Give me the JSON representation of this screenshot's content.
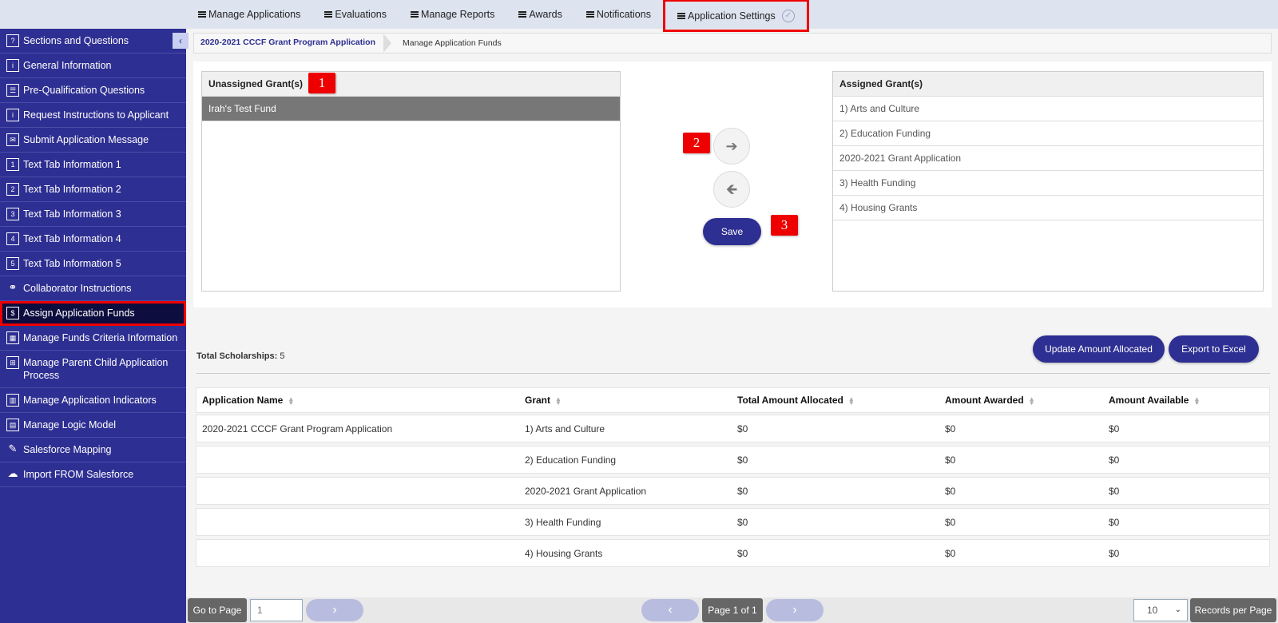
{
  "topnav": {
    "items": [
      {
        "label": "Manage Applications"
      },
      {
        "label": "Evaluations"
      },
      {
        "label": "Manage Reports"
      },
      {
        "label": "Awards"
      },
      {
        "label": "Notifications"
      },
      {
        "label": "Application Settings"
      }
    ]
  },
  "sidebar": {
    "items": [
      {
        "label": "Sections and Questions",
        "icon": "?"
      },
      {
        "label": "General Information",
        "icon": "i"
      },
      {
        "label": "Pre-Qualification Questions",
        "icon": "☰"
      },
      {
        "label": "Request Instructions to Applicant",
        "icon": "i"
      },
      {
        "label": "Submit Application Message",
        "icon": "✉"
      },
      {
        "label": "Text Tab Information 1",
        "icon": "1"
      },
      {
        "label": "Text Tab Information 2",
        "icon": "2"
      },
      {
        "label": "Text Tab Information 3",
        "icon": "3"
      },
      {
        "label": "Text Tab Information 4",
        "icon": "4"
      },
      {
        "label": "Text Tab Information 5",
        "icon": "5"
      },
      {
        "label": "Collaborator Instructions",
        "icon": "⚭"
      },
      {
        "label": "Assign Application Funds",
        "icon": "$"
      },
      {
        "label": "Manage Funds Criteria Information",
        "icon": "▦"
      },
      {
        "label": "Manage Parent Child Application Process",
        "icon": "⊞"
      },
      {
        "label": "Manage Application Indicators",
        "icon": "▥"
      },
      {
        "label": "Manage Logic Model",
        "icon": "▤"
      },
      {
        "label": "Salesforce Mapping",
        "icon": "✎"
      },
      {
        "label": "Import FROM Salesforce",
        "icon": "☁"
      }
    ]
  },
  "breadcrumb": {
    "link": "2020-2021 CCCF Grant Program Application",
    "current": "Manage Application Funds"
  },
  "unassigned": {
    "header": "Unassigned Grant(s)",
    "items": [
      "Irah's Test Fund"
    ]
  },
  "assigned": {
    "header": "Assigned Grant(s)",
    "items": [
      "1) Arts and Culture",
      "2) Education Funding",
      "2020-2021 Grant Application",
      "3) Health Funding",
      "4) Housing Grants"
    ]
  },
  "badges": {
    "one": "1",
    "two": "2",
    "three": "3"
  },
  "buttons": {
    "move_right": "➔",
    "move_left": "🡸",
    "save": "Save",
    "update_amount": "Update Amount Allocated",
    "export_excel": "Export to Excel"
  },
  "total": {
    "label": "Total Scholarships:",
    "value": "5"
  },
  "table": {
    "headers": [
      "Application Name",
      "Grant",
      "Total Amount Allocated",
      "Amount Awarded",
      "Amount Available"
    ],
    "rows": [
      [
        "2020-2021 CCCF Grant Program Application",
        "1) Arts and Culture",
        "$0",
        "$0",
        "$0"
      ],
      [
        "",
        "2) Education Funding",
        "$0",
        "$0",
        "$0"
      ],
      [
        "",
        "2020-2021 Grant Application",
        "$0",
        "$0",
        "$0"
      ],
      [
        "",
        "3) Health Funding",
        "$0",
        "$0",
        "$0"
      ],
      [
        "",
        "4) Housing Grants",
        "$0",
        "$0",
        "$0"
      ]
    ]
  },
  "pager": {
    "go_to_page": "Go to Page",
    "page_input": "1",
    "page_status": "Page 1 of 1",
    "per_page_value": "10",
    "records_per_page": "Records per Page"
  },
  "colors": {
    "brand": "#2e2f92",
    "highlight": "#ee0000"
  }
}
